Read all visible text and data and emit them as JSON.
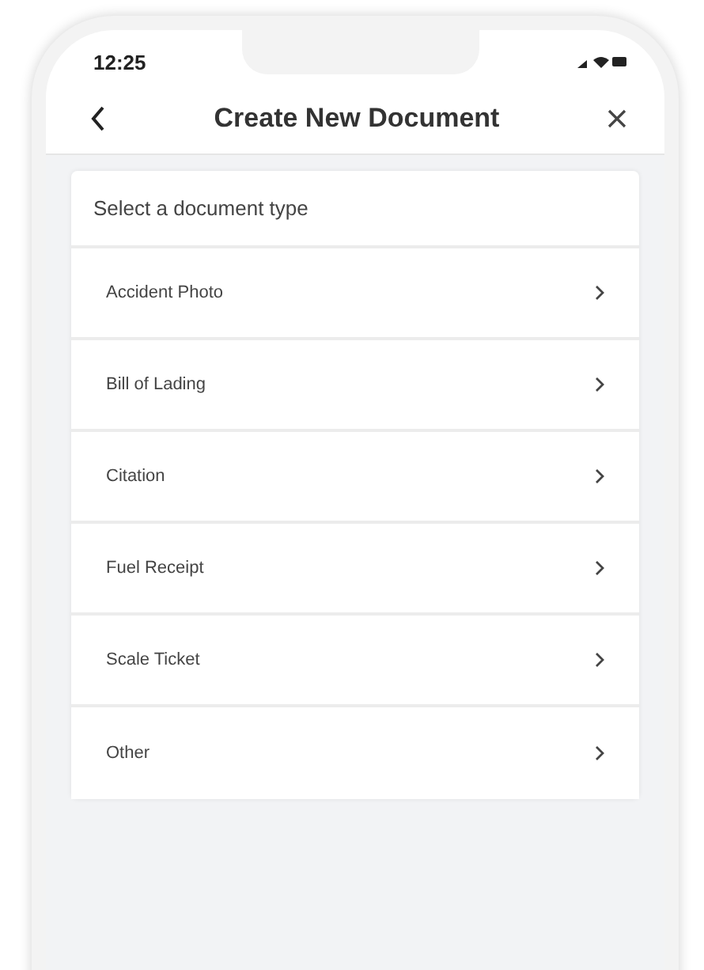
{
  "status_bar": {
    "time": "12:25"
  },
  "header": {
    "title": "Create New Document"
  },
  "list": {
    "heading": "Select a document type",
    "items": [
      {
        "label": "Accident Photo"
      },
      {
        "label": "Bill of Lading"
      },
      {
        "label": "Citation"
      },
      {
        "label": "Fuel Receipt"
      },
      {
        "label": "Scale Ticket"
      },
      {
        "label": "Other"
      }
    ]
  }
}
